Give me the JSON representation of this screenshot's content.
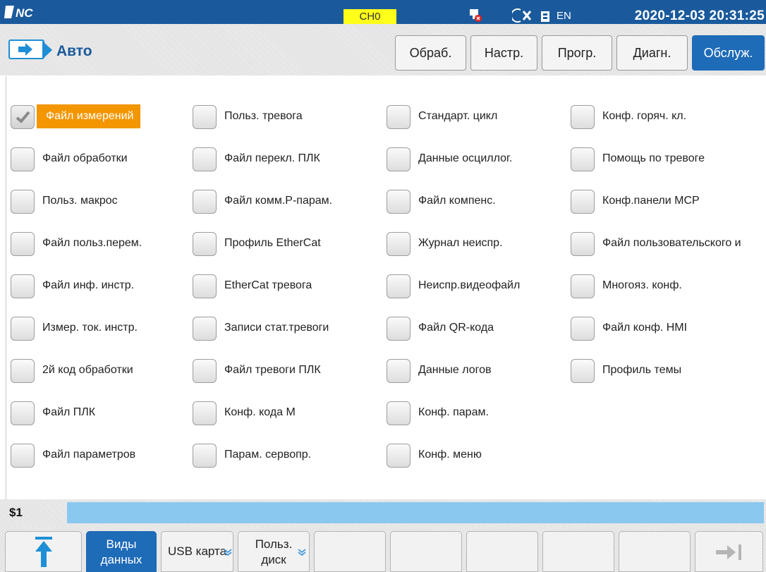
{
  "status_bar": {
    "channel": "CH0",
    "language": "EN",
    "datetime": "2020-12-03 20:31:25",
    "icons": [
      "logo-icon",
      "network-error-icon",
      "close-icon",
      "battery-icon"
    ]
  },
  "header": {
    "mode_icon": "arrow-right-icon",
    "mode_title": "Авто",
    "tabs": [
      {
        "label": "Обраб.",
        "active": false
      },
      {
        "label": "Настр.",
        "active": false
      },
      {
        "label": "Прогр.",
        "active": false
      },
      {
        "label": "Диагн.",
        "active": false
      },
      {
        "label": "Обслуж.",
        "active": true
      }
    ]
  },
  "file_types": {
    "columns": [
      [
        {
          "label": "Файл измерений",
          "checked": true
        },
        {
          "label": "Файл обработки",
          "checked": false
        },
        {
          "label": "Польз. макрос",
          "checked": false
        },
        {
          "label": "Файл польз.перем.",
          "checked": false
        },
        {
          "label": "Файл инф. инстр.",
          "checked": false
        },
        {
          "label": "Измер. ток. инстр.",
          "checked": false
        },
        {
          "label": "2й код обработки",
          "checked": false
        },
        {
          "label": "Файл ПЛК",
          "checked": false
        },
        {
          "label": "Файл параметров",
          "checked": false
        }
      ],
      [
        {
          "label": "Польз. тревога",
          "checked": false
        },
        {
          "label": "Файл перекл. ПЛК",
          "checked": false
        },
        {
          "label": "Файл комм.P-парам.",
          "checked": false
        },
        {
          "label": "Профиль EtherCat",
          "checked": false
        },
        {
          "label": "EtherCat тревога",
          "checked": false
        },
        {
          "label": "Записи стат.тревоги",
          "checked": false
        },
        {
          "label": "Файл тревоги ПЛК",
          "checked": false
        },
        {
          "label": "Конф. кода М",
          "checked": false
        },
        {
          "label": "Парам. сервопр.",
          "checked": false
        }
      ],
      [
        {
          "label": "Стандарт. цикл",
          "checked": false
        },
        {
          "label": "Данные осциллог.",
          "checked": false
        },
        {
          "label": "Файл компенс.",
          "checked": false
        },
        {
          "label": "Журнал неиспр.",
          "checked": false
        },
        {
          "label": "Неиспр.видеофайл",
          "checked": false
        },
        {
          "label": "Файл QR-кода",
          "checked": false
        },
        {
          "label": "Данные логов",
          "checked": false
        },
        {
          "label": "Конф. парам.",
          "checked": false
        },
        {
          "label": "Конф. меню",
          "checked": false
        }
      ],
      [
        {
          "label": "Конф. горяч. кл.",
          "checked": false
        },
        {
          "label": "Помощь по тревоге",
          "checked": false
        },
        {
          "label": "Конф.панели MCP",
          "checked": false
        },
        {
          "label": "Файл пользовательского и",
          "checked": false
        },
        {
          "label": "Многояз. конф.",
          "checked": false
        },
        {
          "label": "Файл конф. HMI",
          "checked": false
        },
        {
          "label": "Профиль темы",
          "checked": false
        }
      ]
    ]
  },
  "command": {
    "prompt": "$1",
    "value": ""
  },
  "softkeys": [
    {
      "label": "",
      "icon": "upload-arrow-icon"
    },
    {
      "label": "Виды данных",
      "line1": "Виды",
      "line2": "данных",
      "active": true
    },
    {
      "label": "USB карта",
      "dropdown": true
    },
    {
      "label": "Польз. диск",
      "line1": "Польз.",
      "line2": "диск",
      "dropdown": true
    },
    {
      "label": ""
    },
    {
      "label": ""
    },
    {
      "label": ""
    },
    {
      "label": ""
    },
    {
      "label": ""
    },
    {
      "label": "",
      "icon": "next-page-icon"
    }
  ],
  "colors": {
    "topbar": "#1a5a9c",
    "accent_blue": "#1e6bb8",
    "selection_orange": "#f39600",
    "channel_yellow": "#ffff1a",
    "command_bar": "#8bc8ef"
  }
}
